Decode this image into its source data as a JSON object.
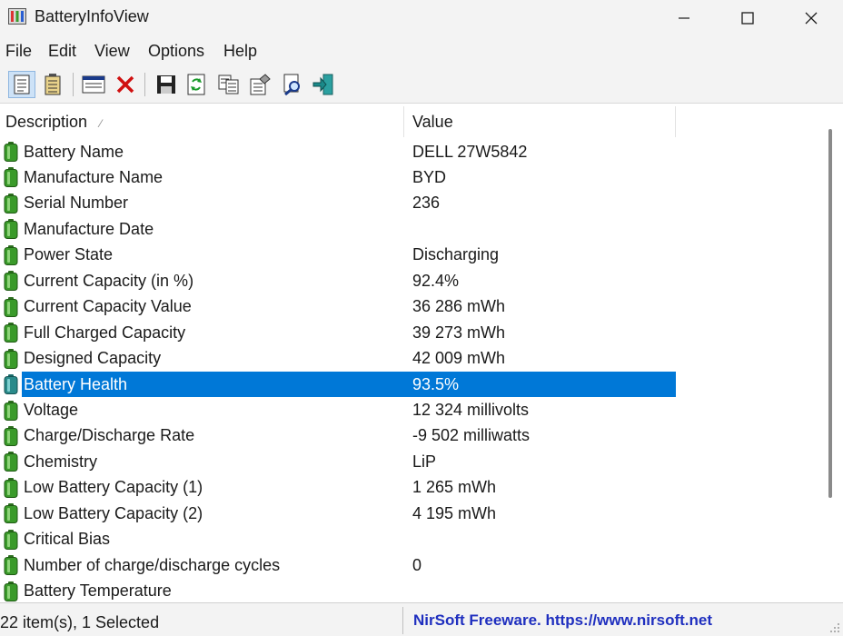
{
  "window": {
    "title": "BatteryInfoView",
    "minimize_icon": "minimize-icon",
    "maximize_icon": "maximize-icon",
    "close_icon": "close-icon"
  },
  "menu": [
    "File",
    "Edit",
    "View",
    "Options",
    "Help"
  ],
  "toolbar": [
    {
      "name": "battery-info-mode-icon",
      "active": true
    },
    {
      "name": "battery-log-mode-icon",
      "active": false
    },
    {
      "name": "properties-icon",
      "active": false
    },
    {
      "name": "delete-icon",
      "active": false
    },
    {
      "name": "save-icon",
      "active": false
    },
    {
      "name": "refresh-icon",
      "active": false
    },
    {
      "name": "copy-icon",
      "active": false
    },
    {
      "name": "html-report-icon",
      "active": false
    },
    {
      "name": "find-icon",
      "active": false
    },
    {
      "name": "exit-icon",
      "active": false
    }
  ],
  "columns": {
    "description": "Description",
    "value": "Value"
  },
  "rows": [
    {
      "description": "Battery Name",
      "value": "DELL 27W5842"
    },
    {
      "description": "Manufacture Name",
      "value": "BYD"
    },
    {
      "description": "Serial Number",
      "value": "236"
    },
    {
      "description": "Manufacture Date",
      "value": ""
    },
    {
      "description": "Power State",
      "value": "Discharging"
    },
    {
      "description": "Current Capacity (in %)",
      "value": "92.4%"
    },
    {
      "description": "Current Capacity Value",
      "value": "36 286 mWh"
    },
    {
      "description": "Full Charged Capacity",
      "value": "39 273 mWh"
    },
    {
      "description": "Designed Capacity",
      "value": "42 009 mWh"
    },
    {
      "description": "Battery Health",
      "value": "93.5%",
      "selected": true
    },
    {
      "description": "Voltage",
      "value": "12 324 millivolts"
    },
    {
      "description": "Charge/Discharge Rate",
      "value": "-9 502 milliwatts"
    },
    {
      "description": "Chemistry",
      "value": "LiP"
    },
    {
      "description": "Low Battery Capacity (1)",
      "value": "1 265 mWh"
    },
    {
      "description": "Low Battery Capacity (2)",
      "value": "4 195 mWh"
    },
    {
      "description": "Critical Bias",
      "value": ""
    },
    {
      "description": "Number of charge/discharge cycles",
      "value": "0"
    },
    {
      "description": "Battery Temperature",
      "value": ""
    }
  ],
  "status": {
    "items": "22 item(s), 1 Selected",
    "credit": "NirSoft Freeware. https://www.nirsoft.net"
  },
  "colors": {
    "selection": "#0078d7",
    "battery_green": "#3a9a2a",
    "credit_text": "#1f2fbf"
  }
}
